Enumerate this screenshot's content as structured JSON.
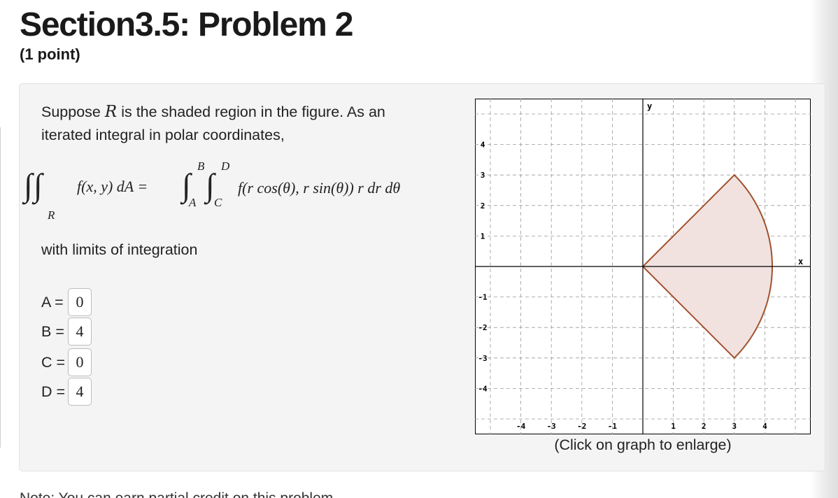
{
  "header": {
    "title": "Section3.5: Problem 2",
    "points": "(1 point)"
  },
  "problem": {
    "text_suppose": "Suppose",
    "var_R": "R",
    "text_rest": "is the shaded region in the figure. As an iterated integral in polar coordinates,",
    "equation": {
      "lhs_integrand": "f(x, y) dA =",
      "lhs_region": "R",
      "upper_outer": "B",
      "lower_outer": "A",
      "upper_inner": "D",
      "lower_inner": "C",
      "rhs_integrand": "f(r cos(θ), r sin(θ)) r dr dθ"
    },
    "limits_text": "with limits of integration",
    "answers": [
      {
        "label": "A =",
        "value": "0"
      },
      {
        "label": "B =",
        "value": "4"
      },
      {
        "label": "C =",
        "value": "0"
      },
      {
        "label": "D =",
        "value": "4"
      }
    ]
  },
  "graph": {
    "x_label": "x",
    "y_label": "y",
    "x_ticks": [
      "-4",
      "-3",
      "-2",
      "-1",
      "1",
      "2",
      "3",
      "4"
    ],
    "y_ticks": [
      "4",
      "3",
      "2",
      "1",
      "-1",
      "-2",
      "-3",
      "-4"
    ],
    "caption": "(Click on graph to enlarge)",
    "colors": {
      "region_fill": "#f1e2e0",
      "region_stroke": "#a0522d",
      "grid": "#999999",
      "axes": "#000000"
    }
  },
  "footer_partial": "Note: You can earn partial credit on this problem."
}
